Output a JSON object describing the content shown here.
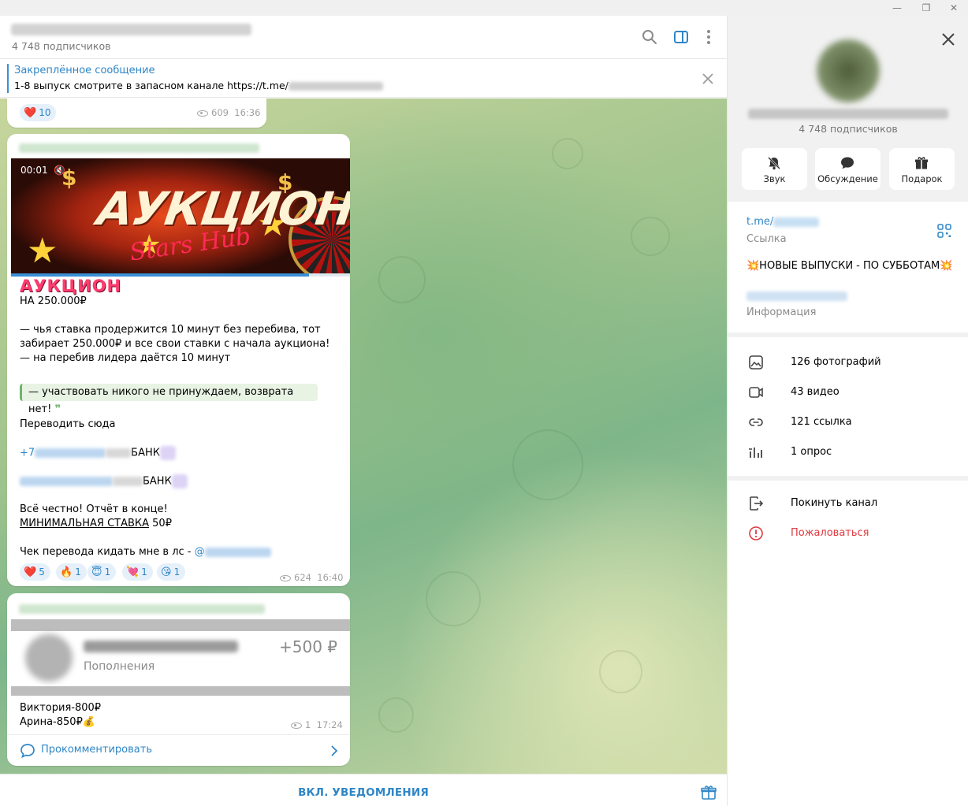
{
  "window": {
    "minimize": "—",
    "restore": "❐",
    "close": "✕"
  },
  "chat": {
    "subscribers": "4 748 подписчиков",
    "pinned": {
      "title": "Закреплённое сообщение",
      "text": "1-8 выпуск смотрите в запасном канале https://t.me/"
    }
  },
  "messages": {
    "m1": {
      "reactions": [
        {
          "emoji": "❤️",
          "count": "10"
        }
      ],
      "views": "609",
      "time": "16:36"
    },
    "m2": {
      "video_time": "00:01",
      "video_progress": 0.88,
      "video_title": "АУКЦИОН",
      "video_script": "Stars Hub",
      "heading": "АУКЦИОН",
      "line1": "НА 250.000₽",
      "line2": "— чья ставка продержится 10 минут без перебива, тот",
      "line3": "забирает 250.000₽ и все свои ставки с начала аукциона!",
      "line4": "— на перебив лидера даётся 10 минут",
      "quote": "— участвовать никого не принуждаем, возврата нет!",
      "transfer_here": "Переводить сюда",
      "phone_prefix": "+7",
      "bank1": "БАНК",
      "bank2": "БАНК",
      "honest": "Всё честно! Отчёт в конце!",
      "min_bet_label": "МИНИМАЛЬНАЯ СТАВКА",
      "min_bet_value": " 50₽",
      "receipt": "Чек перевода кидать мне в лс - ",
      "at": "@",
      "reactions": [
        {
          "emoji": "❤️",
          "count": "5"
        },
        {
          "emoji": "🔥",
          "count": "1"
        },
        {
          "emoji": "😇",
          "count": "1"
        },
        {
          "emoji": "💘",
          "count": "1"
        },
        {
          "emoji": "😘",
          "count": "1"
        }
      ],
      "views": "624",
      "time": "16:40"
    },
    "m3": {
      "transfer_sub": "Пополнения",
      "transfer_amount": "+500 ₽",
      "line1": "Виктория-800₽",
      "line2": "Арина-850₽💰",
      "views": "1",
      "time": "17:24",
      "comment": "Прокомментировать"
    }
  },
  "bottom": {
    "notify": "ВКЛ. УВЕДОМЛЕНИЯ"
  },
  "panel": {
    "subscribers": "4 748 подписчиков",
    "actions": [
      {
        "label": "Звук",
        "icon": "bell-off-icon"
      },
      {
        "label": "Обсуждение",
        "icon": "chat-bubble-icon"
      },
      {
        "label": "Подарок",
        "icon": "gift-icon"
      }
    ],
    "link_prefix": "t.me/",
    "link_label": "Ссылка",
    "description": "💥НОВЫЕ ВЫПУСКИ - ПО СУББОТАМ💥",
    "info_label": "Информация",
    "media": [
      {
        "label": "126 фотографий",
        "icon": "photo-icon"
      },
      {
        "label": "43 видео",
        "icon": "video-icon"
      },
      {
        "label": "121 ссылка",
        "icon": "link-icon"
      },
      {
        "label": "1 опрос",
        "icon": "poll-icon"
      }
    ],
    "leave": "Покинуть канал",
    "report": "Пожаловаться"
  },
  "colors": {
    "accent": "#2f86c6",
    "danger": "#e0393e",
    "reaction_bg": "#e6f0fa"
  }
}
